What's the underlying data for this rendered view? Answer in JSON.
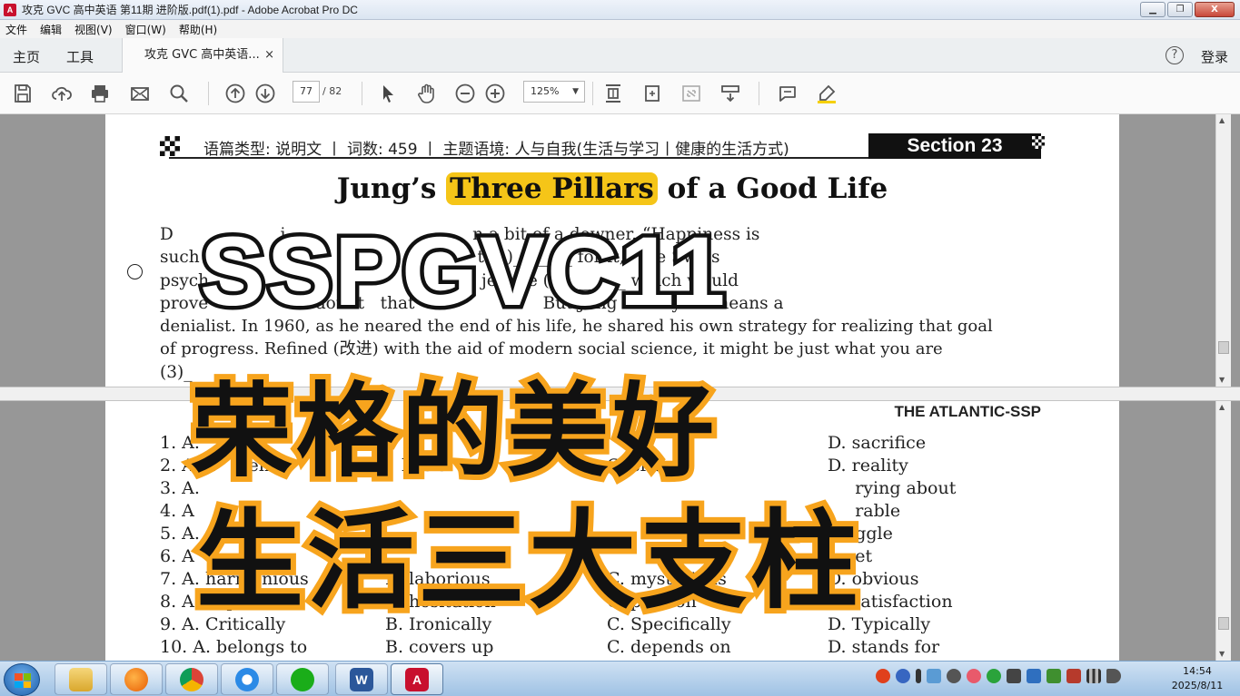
{
  "window": {
    "title": "攻克 GVC 高中英语 第11期 进阶版.pdf(1).pdf - Adobe Acrobat Pro DC",
    "app_icon_text": "A",
    "buttons": [
      "▁",
      "❐",
      "X"
    ]
  },
  "menu": [
    "文件",
    "编辑",
    "视图(V)",
    "窗口(W)",
    "帮助(H)"
  ],
  "nav": {
    "home": "主页",
    "tools": "工具",
    "doc_tab": "攻克 GVC 高中英语...",
    "tab_close": "×",
    "help": "?",
    "login": "登录"
  },
  "toolbar": {
    "icons": [
      "save-icon",
      "upload-icon",
      "print-icon",
      "email-icon",
      "search-icon",
      "page-up-icon",
      "page-down-icon",
      "select-cursor-icon",
      "hand-icon",
      "zoom-out-icon",
      "zoom-in-icon",
      "page-fit-icon",
      "rotate-icon",
      "fullscreen-icon",
      "tools-menu-icon",
      "comment-icon",
      "highlight-icon"
    ],
    "page_current": "77",
    "page_total": "/ 82",
    "zoom": "125%",
    "zoom_caret": "▼"
  },
  "document": {
    "header_text": "语篇类型: 说明文 丨 词数: 459 丨 主题语境: 人与自我(生活与学习丨健康的生活方式)",
    "section": "Section 23",
    "title_pre": "Jung’s ",
    "title_highlight": "Three Pillars",
    "title_post": " of a Good Life",
    "paragraph_lines": [
      "D                    i                                   n a bit of a downer. “Happiness is",
      "such                                                    t (1)_______ for it,” the Swiss",
      "psych                                                   jective (2)_______ which would",
      "prove                    doubt   that                        But Jung was by no means a",
      "denialist. In 1960, as he neared the end of his life, he shared his own strategy for realizing that goal",
      "of progress. Refined (改进) with the aid of modern social science, it might be just what you are",
      "(3)_"
    ],
    "source": "THE ATLANTIC-SSP",
    "options": [
      [
        "1. A.",
        "",
        "",
        "D. sacrifice"
      ],
      [
        "2. A. a      ent",
        "   basis",
        "C. criteri",
        "D. reality"
      ],
      [
        "3. A.",
        "",
        "",
        "     rying about"
      ],
      [
        "4. A",
        "",
        "",
        "     rable"
      ],
      [
        "5. A.",
        "",
        "",
        "     ggle"
      ],
      [
        "6. A",
        "",
        "",
        "     et"
      ],
      [
        "7. A. harmonious",
        "B. laborious",
        "C. mysterious",
        "D. obvious"
      ],
      [
        "8. A. depression",
        "B. hesitation",
        "C. passion",
        "D. satisfaction"
      ],
      [
        "9. A. Critically",
        "B. Ironically",
        "C. Specifically",
        "D. Typically"
      ],
      [
        "10. A. belongs to",
        "B. covers up",
        "C. depends on",
        "D. stands for"
      ]
    ]
  },
  "overlay": {
    "code": "SSPGVC11",
    "line1": "荣格的美好",
    "line2": "生活三大支柱"
  },
  "taskbar": {
    "apps": [
      "file-explorer",
      "firefox",
      "chrome",
      "baidu-netdisk",
      "wechat",
      "word",
      "acrobat"
    ],
    "clock_time": "14:54",
    "clock_date": "2025/8/11"
  },
  "colors": {
    "highlight": "#f5c518",
    "overlay_orange": "#f7a41d",
    "taskbar": "#a9c8e8"
  }
}
